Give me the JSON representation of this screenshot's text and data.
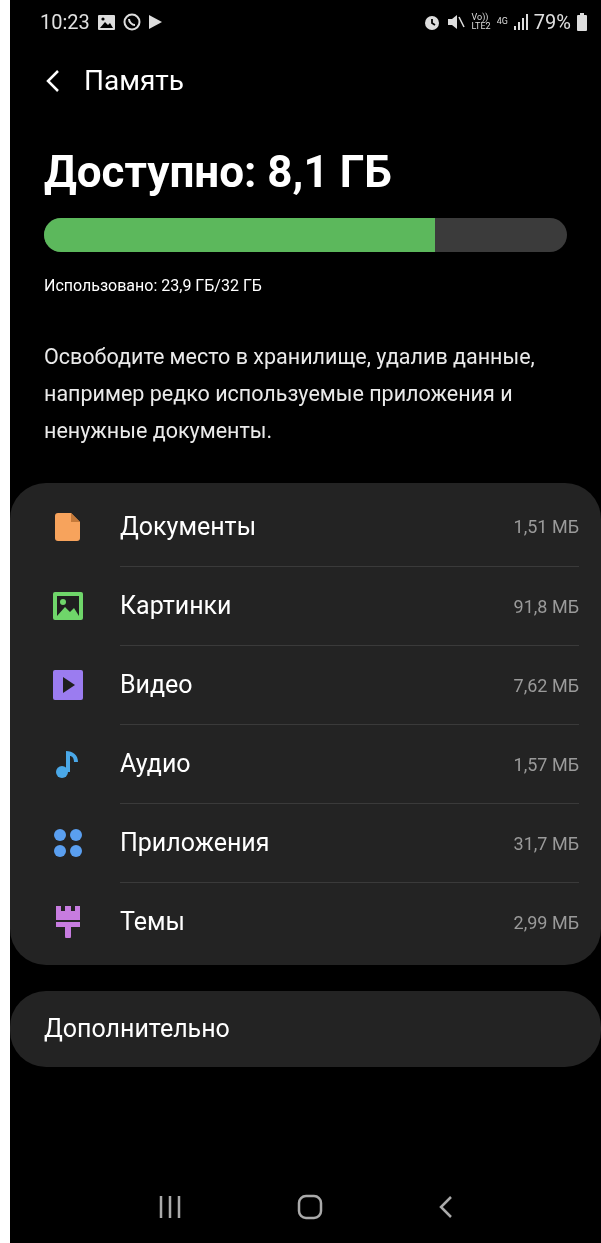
{
  "status_bar": {
    "time": "10:23",
    "network_top": "Vo))",
    "network_bottom": "LTE2",
    "data_type": "4G",
    "battery": "79%"
  },
  "header": {
    "title": "Память"
  },
  "storage": {
    "available": "Доступно: 8,1 ГБ",
    "level": 0.747,
    "used": "Использовано: 23,9 ГБ/32 ГБ"
  },
  "hint": "Освободите место в хранилище, удалив данные, например редко используемые приложения и ненужные документы.",
  "categories": [
    {
      "kind": "documents",
      "label": "Документы",
      "size": "1,51 МБ"
    },
    {
      "kind": "images",
      "label": "Картинки",
      "size": "91,8 МБ"
    },
    {
      "kind": "video",
      "label": "Видео",
      "size": "7,62 МБ"
    },
    {
      "kind": "audio",
      "label": "Аудио",
      "size": "1,57 МБ"
    },
    {
      "kind": "apps",
      "label": "Приложения",
      "size": "31,7 МБ"
    },
    {
      "kind": "themes",
      "label": "Темы",
      "size": "2,99 МБ"
    }
  ],
  "advanced": {
    "label": "Дополнительно"
  }
}
